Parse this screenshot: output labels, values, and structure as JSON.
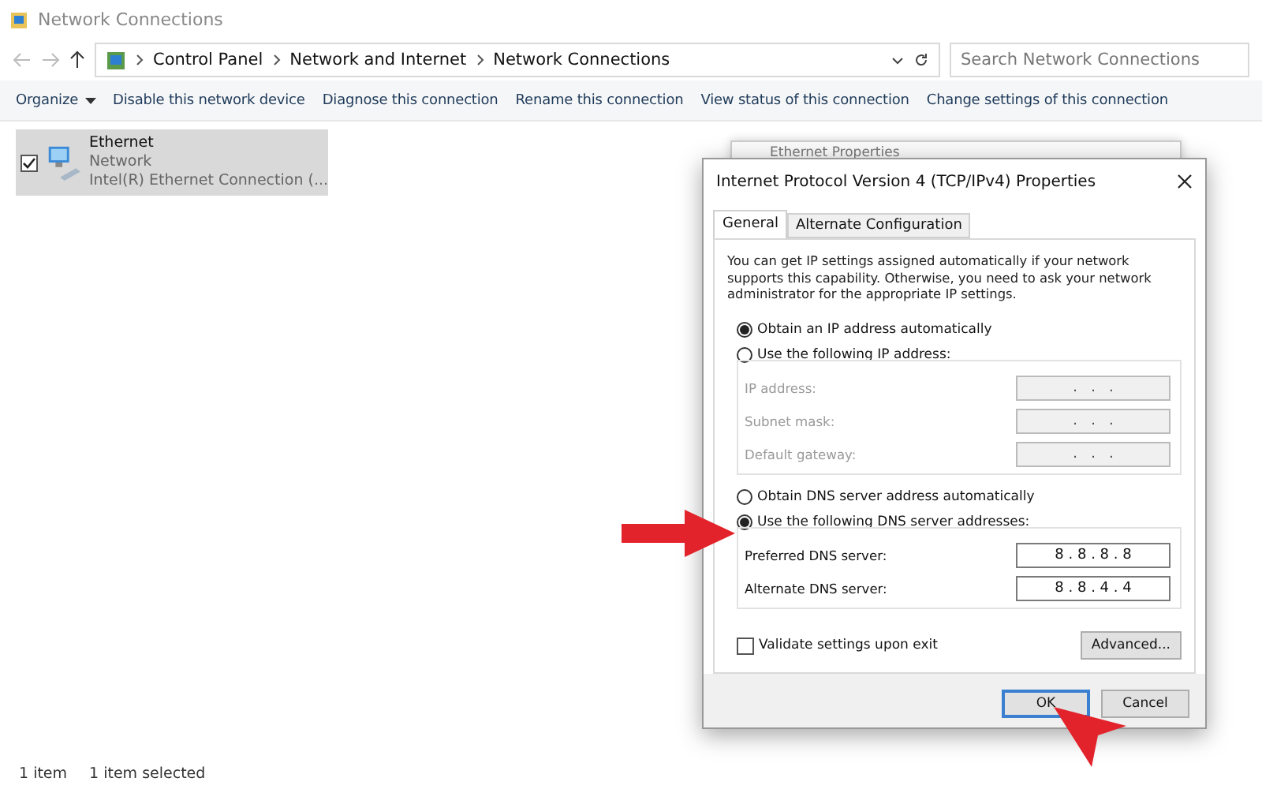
{
  "window": {
    "title": "Network Connections"
  },
  "address_bar": {
    "breadcrumbs": [
      "Control Panel",
      "Network and Internet",
      "Network Connections"
    ],
    "search": {
      "placeholder": "Search Network Connections"
    }
  },
  "toolbar": [
    {
      "label": "Organize",
      "dropdown": true
    },
    {
      "label": "Disable this network device",
      "dropdown": false
    },
    {
      "label": "Diagnose this connection",
      "dropdown": false
    },
    {
      "label": "Rename this connection",
      "dropdown": false
    },
    {
      "label": "View status of this connection",
      "dropdown": false
    },
    {
      "label": "Change settings of this connection",
      "dropdown": false
    }
  ],
  "connections": [
    {
      "name": "Ethernet",
      "network": "Network",
      "device": "Intel(R) Ethernet Connection (...",
      "checked": true,
      "selected": true
    }
  ],
  "status_bar": [
    "1 item",
    "1 item selected"
  ],
  "back_dialog": {
    "title": "Ethernet Properties"
  },
  "dialog": {
    "title": "Internet Protocol Version 4 (TCP/IPv4) Properties",
    "tabs": [
      {
        "label": "General",
        "selected": true
      },
      {
        "label": "Alternate Configuration",
        "selected": false
      }
    ],
    "intro": "You can get IP settings assigned automatically if your network supports this capability. Otherwise, you need to ask your network administrator for the appropriate IP settings.",
    "ip_options": [
      {
        "label": "Obtain an IP address automatically",
        "selected": true
      },
      {
        "label": "Use the following IP address:",
        "selected": false
      }
    ],
    "ip_fields": [
      {
        "label": "IP address:",
        "value": ".   .   .",
        "disabled": true
      },
      {
        "label": "Subnet mask:",
        "value": ".   .   .",
        "disabled": true
      },
      {
        "label": "Default gateway:",
        "value": ".   .   .",
        "disabled": true
      }
    ],
    "dns_options": [
      {
        "label": "Obtain DNS server address automatically",
        "selected": false
      },
      {
        "label": "Use the following DNS server addresses:",
        "selected": true
      }
    ],
    "dns_fields": [
      {
        "label": "Preferred DNS server:",
        "value": "8 . 8 . 8 . 8",
        "disabled": false
      },
      {
        "label": "Alternate DNS server:",
        "value": "8 . 8 . 4 . 4",
        "disabled": false
      }
    ],
    "validate": {
      "label": "Validate settings upon exit",
      "checked": false
    },
    "advanced": "Advanced...",
    "buttons": [
      {
        "label": "OK",
        "default": true
      },
      {
        "label": "Cancel",
        "default": false
      }
    ]
  }
}
